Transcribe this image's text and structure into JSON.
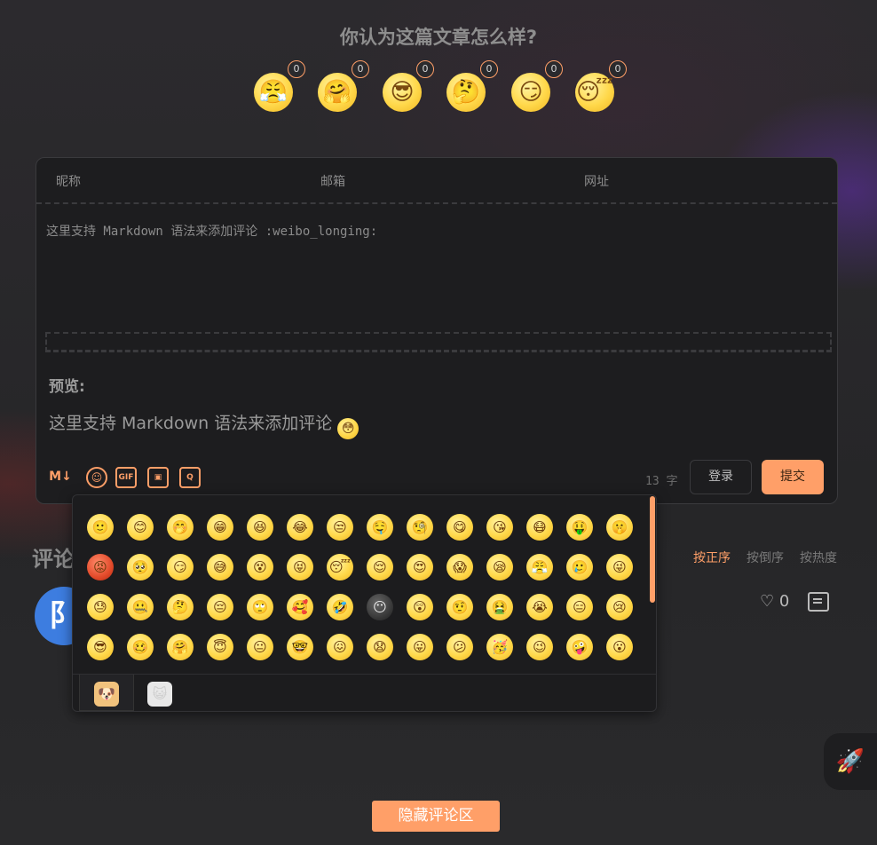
{
  "reactions": {
    "title": "你认为这篇文章怎么样?",
    "items": [
      {
        "glyph": "😤",
        "count": "0"
      },
      {
        "glyph": "🤗",
        "count": "0"
      },
      {
        "glyph": "😎",
        "count": "0"
      },
      {
        "glyph": "🤔",
        "count": "0"
      },
      {
        "glyph": "😏",
        "count": "0"
      },
      {
        "glyph": "😴",
        "count": "0"
      }
    ]
  },
  "form": {
    "nick_placeholder": "昵称",
    "mail_placeholder": "邮箱",
    "link_placeholder": "网址",
    "editor_text": "这里支持 Markdown 语法来添加评论 :weibo_longing:",
    "preview_label": "预览:",
    "preview_text": "这里支持 Markdown 语法来添加评论",
    "preview_emoji": "😳",
    "word_count": "13 字",
    "login_label": "登录",
    "submit_label": "提交",
    "tools": [
      "M↓",
      "☺",
      "GIF",
      "▣",
      "Q"
    ]
  },
  "comments": {
    "title": "评论",
    "sort_options": [
      "按正序",
      "按倒序",
      "按热度"
    ],
    "active_sort": "按正序",
    "like_count": "0",
    "avatar_glyph": "阝"
  },
  "emoji_popup": {
    "rows": [
      [
        "🙂",
        "😊",
        "🤭",
        "😁",
        "😆",
        "😂",
        "😒",
        "🤤",
        "🧐",
        "😋",
        "😘",
        "😷",
        "🤑",
        "🤫"
      ],
      [
        "😡",
        "🥺",
        "😏",
        "😅",
        "😵",
        "😝",
        "😴",
        "😌",
        "😍",
        "😱",
        "😪",
        "😤",
        "🥲",
        "😜"
      ],
      [
        "😓",
        "🤐",
        "🤔",
        "😔",
        "🙄",
        "🥰",
        "🤣",
        "😶",
        "😲",
        "🤨",
        "🤮",
        "😭",
        "😑",
        "😢"
      ],
      [
        "😎",
        "🥴",
        "🤗",
        "😇",
        "😐",
        "🤓",
        "😖",
        "😧",
        "😛",
        "😕",
        "🥳",
        "😉",
        "🤪",
        "😮"
      ]
    ],
    "tabs": [
      "🐶",
      "😺"
    ]
  },
  "footer": {
    "hide_label": "隐藏评论区",
    "rocket_glyph": "🚀"
  }
}
